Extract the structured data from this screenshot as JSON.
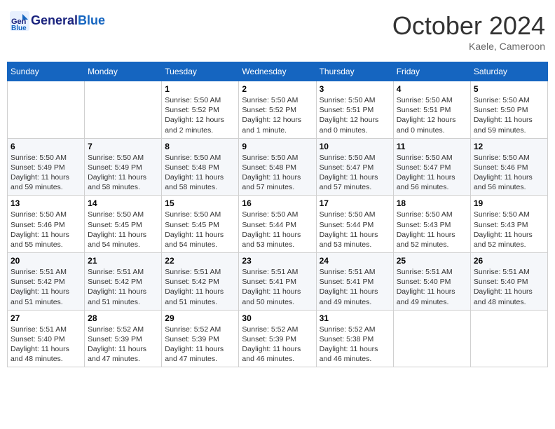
{
  "header": {
    "logo_line1": "General",
    "logo_line2": "Blue",
    "month_year": "October 2024",
    "location": "Kaele, Cameroon"
  },
  "weekdays": [
    "Sunday",
    "Monday",
    "Tuesday",
    "Wednesday",
    "Thursday",
    "Friday",
    "Saturday"
  ],
  "weeks": [
    [
      {
        "day": "",
        "info": ""
      },
      {
        "day": "",
        "info": ""
      },
      {
        "day": "1",
        "info": "Sunrise: 5:50 AM\nSunset: 5:52 PM\nDaylight: 12 hours\nand 2 minutes."
      },
      {
        "day": "2",
        "info": "Sunrise: 5:50 AM\nSunset: 5:52 PM\nDaylight: 12 hours\nand 1 minute."
      },
      {
        "day": "3",
        "info": "Sunrise: 5:50 AM\nSunset: 5:51 PM\nDaylight: 12 hours\nand 0 minutes."
      },
      {
        "day": "4",
        "info": "Sunrise: 5:50 AM\nSunset: 5:51 PM\nDaylight: 12 hours\nand 0 minutes."
      },
      {
        "day": "5",
        "info": "Sunrise: 5:50 AM\nSunset: 5:50 PM\nDaylight: 11 hours\nand 59 minutes."
      }
    ],
    [
      {
        "day": "6",
        "info": "Sunrise: 5:50 AM\nSunset: 5:49 PM\nDaylight: 11 hours\nand 59 minutes."
      },
      {
        "day": "7",
        "info": "Sunrise: 5:50 AM\nSunset: 5:49 PM\nDaylight: 11 hours\nand 58 minutes."
      },
      {
        "day": "8",
        "info": "Sunrise: 5:50 AM\nSunset: 5:48 PM\nDaylight: 11 hours\nand 58 minutes."
      },
      {
        "day": "9",
        "info": "Sunrise: 5:50 AM\nSunset: 5:48 PM\nDaylight: 11 hours\nand 57 minutes."
      },
      {
        "day": "10",
        "info": "Sunrise: 5:50 AM\nSunset: 5:47 PM\nDaylight: 11 hours\nand 57 minutes."
      },
      {
        "day": "11",
        "info": "Sunrise: 5:50 AM\nSunset: 5:47 PM\nDaylight: 11 hours\nand 56 minutes."
      },
      {
        "day": "12",
        "info": "Sunrise: 5:50 AM\nSunset: 5:46 PM\nDaylight: 11 hours\nand 56 minutes."
      }
    ],
    [
      {
        "day": "13",
        "info": "Sunrise: 5:50 AM\nSunset: 5:46 PM\nDaylight: 11 hours\nand 55 minutes."
      },
      {
        "day": "14",
        "info": "Sunrise: 5:50 AM\nSunset: 5:45 PM\nDaylight: 11 hours\nand 54 minutes."
      },
      {
        "day": "15",
        "info": "Sunrise: 5:50 AM\nSunset: 5:45 PM\nDaylight: 11 hours\nand 54 minutes."
      },
      {
        "day": "16",
        "info": "Sunrise: 5:50 AM\nSunset: 5:44 PM\nDaylight: 11 hours\nand 53 minutes."
      },
      {
        "day": "17",
        "info": "Sunrise: 5:50 AM\nSunset: 5:44 PM\nDaylight: 11 hours\nand 53 minutes."
      },
      {
        "day": "18",
        "info": "Sunrise: 5:50 AM\nSunset: 5:43 PM\nDaylight: 11 hours\nand 52 minutes."
      },
      {
        "day": "19",
        "info": "Sunrise: 5:50 AM\nSunset: 5:43 PM\nDaylight: 11 hours\nand 52 minutes."
      }
    ],
    [
      {
        "day": "20",
        "info": "Sunrise: 5:51 AM\nSunset: 5:42 PM\nDaylight: 11 hours\nand 51 minutes."
      },
      {
        "day": "21",
        "info": "Sunrise: 5:51 AM\nSunset: 5:42 PM\nDaylight: 11 hours\nand 51 minutes."
      },
      {
        "day": "22",
        "info": "Sunrise: 5:51 AM\nSunset: 5:42 PM\nDaylight: 11 hours\nand 51 minutes."
      },
      {
        "day": "23",
        "info": "Sunrise: 5:51 AM\nSunset: 5:41 PM\nDaylight: 11 hours\nand 50 minutes."
      },
      {
        "day": "24",
        "info": "Sunrise: 5:51 AM\nSunset: 5:41 PM\nDaylight: 11 hours\nand 49 minutes."
      },
      {
        "day": "25",
        "info": "Sunrise: 5:51 AM\nSunset: 5:40 PM\nDaylight: 11 hours\nand 49 minutes."
      },
      {
        "day": "26",
        "info": "Sunrise: 5:51 AM\nSunset: 5:40 PM\nDaylight: 11 hours\nand 48 minutes."
      }
    ],
    [
      {
        "day": "27",
        "info": "Sunrise: 5:51 AM\nSunset: 5:40 PM\nDaylight: 11 hours\nand 48 minutes."
      },
      {
        "day": "28",
        "info": "Sunrise: 5:52 AM\nSunset: 5:39 PM\nDaylight: 11 hours\nand 47 minutes."
      },
      {
        "day": "29",
        "info": "Sunrise: 5:52 AM\nSunset: 5:39 PM\nDaylight: 11 hours\nand 47 minutes."
      },
      {
        "day": "30",
        "info": "Sunrise: 5:52 AM\nSunset: 5:39 PM\nDaylight: 11 hours\nand 46 minutes."
      },
      {
        "day": "31",
        "info": "Sunrise: 5:52 AM\nSunset: 5:38 PM\nDaylight: 11 hours\nand 46 minutes."
      },
      {
        "day": "",
        "info": ""
      },
      {
        "day": "",
        "info": ""
      }
    ]
  ]
}
